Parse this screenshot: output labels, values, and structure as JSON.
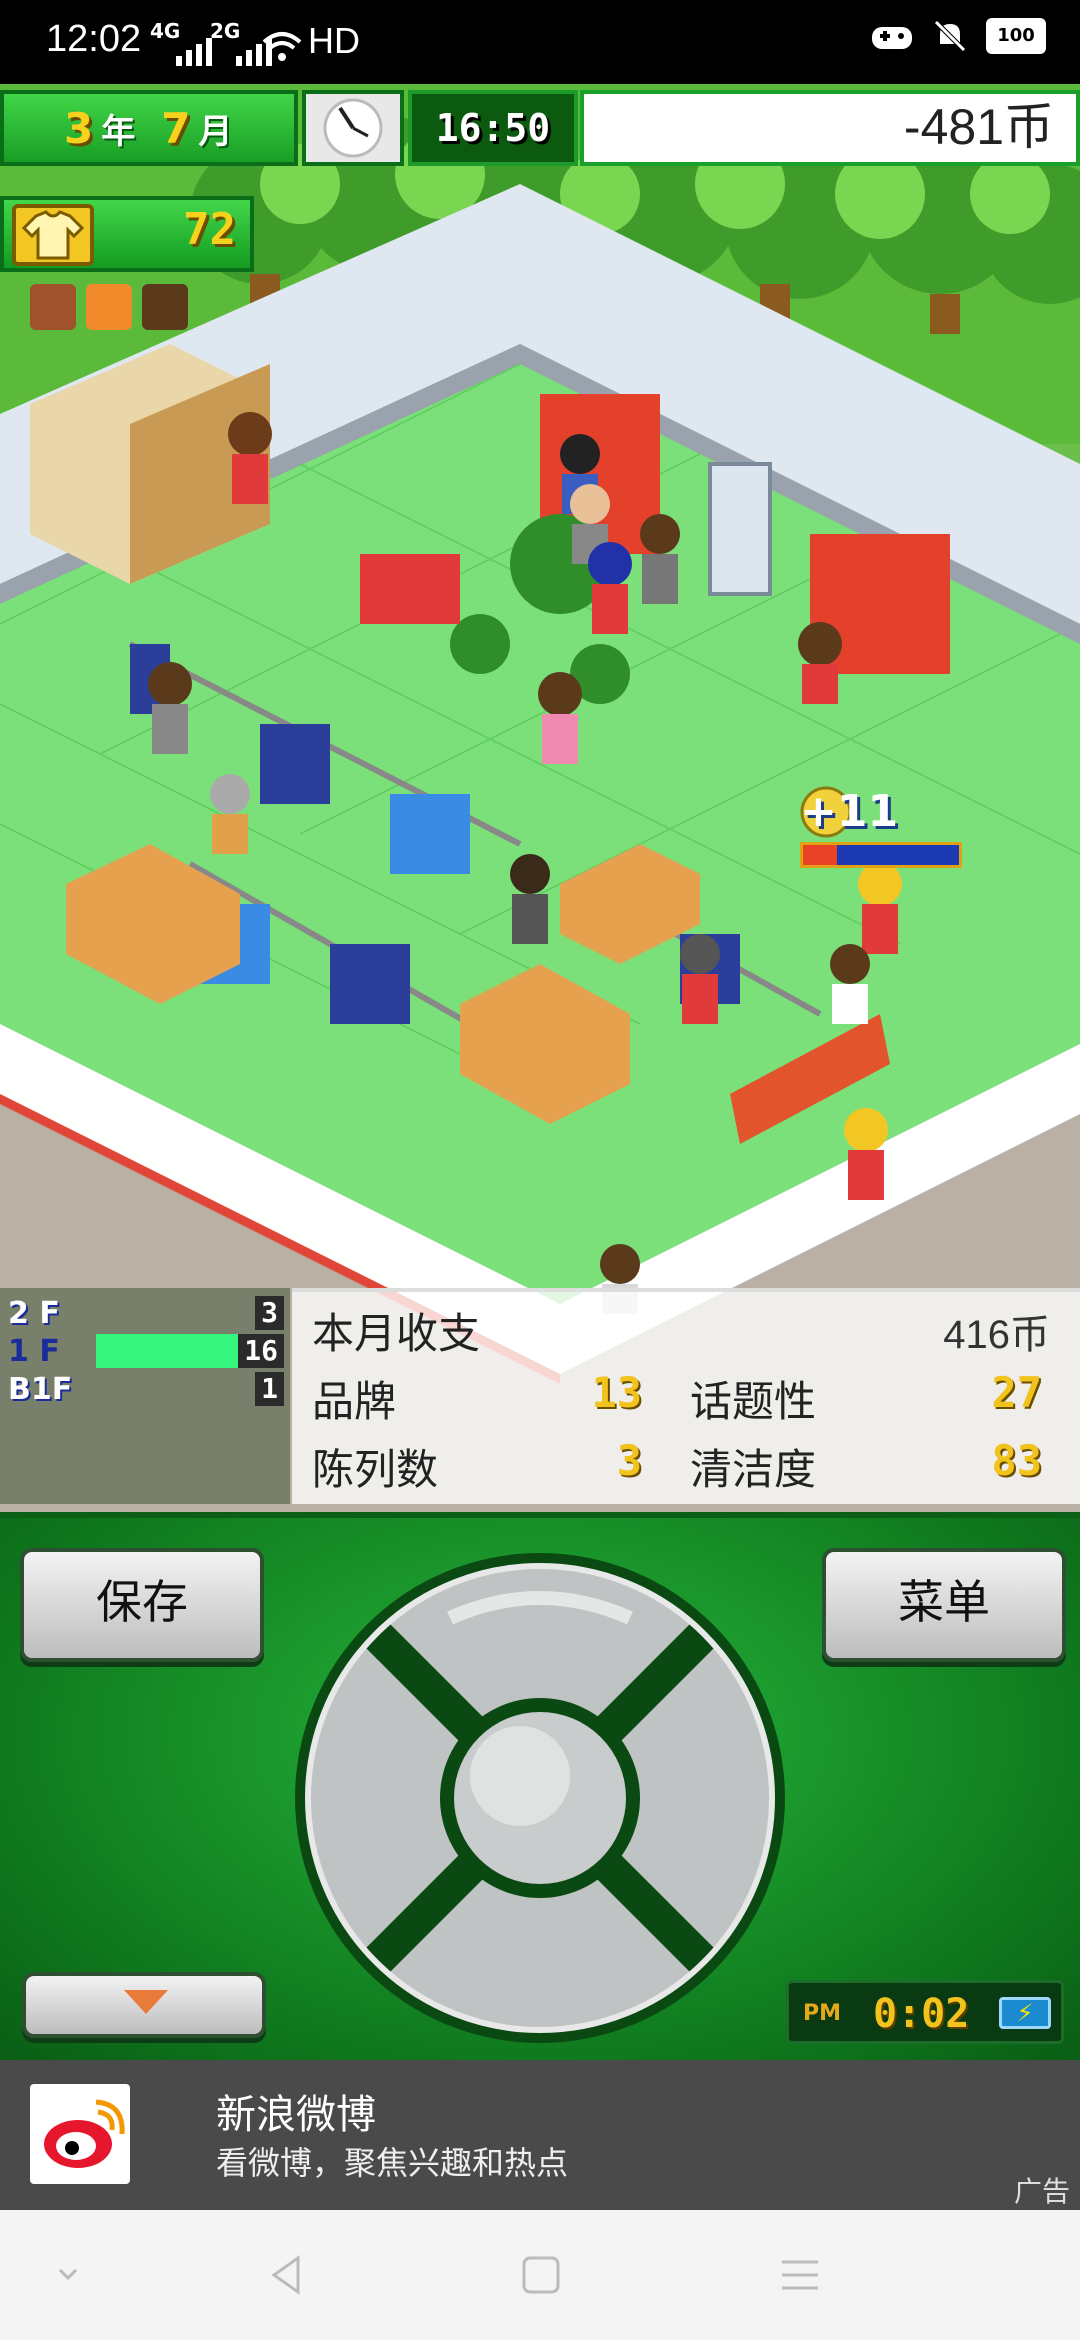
{
  "status_bar": {
    "time": "12:02",
    "sig1_tech": "4G",
    "sig2_tech": "2G",
    "hd_label": "HD",
    "battery": "100"
  },
  "hud": {
    "year_num": "3",
    "year_label": "年",
    "month_num": "7",
    "month_label": "月",
    "time": "16:50",
    "money": "-481币",
    "rank_value": "72",
    "floating_bonus": "+11",
    "floating_bar_fraction": 0.22
  },
  "floors": [
    {
      "label": "2 F",
      "count": "3",
      "active": false
    },
    {
      "label": "1 F",
      "count": "16",
      "active": true
    },
    {
      "label": "B1F",
      "count": "1",
      "active": false
    }
  ],
  "stats": {
    "monthly_label": "本月收支",
    "monthly_value": "416币",
    "brand_label": "品牌",
    "brand_value": "13",
    "topic_label": "话题性",
    "topic_value": "27",
    "display_label": "陈列数",
    "display_value": "3",
    "clean_label": "清洁度",
    "clean_value": "83"
  },
  "controller": {
    "save_label": "保存",
    "menu_label": "菜单",
    "clock_ampm": "PM",
    "clock_time": "0:02"
  },
  "ad": {
    "title": "新浪微博",
    "subtitle": "看微博，聚焦兴趣和热点",
    "tag": "广告"
  },
  "icons": {
    "wifi": "wifi-icon",
    "gamepad": "gamepad-icon",
    "mute": "bell-off-icon",
    "weibo": "weibo-logo-icon"
  },
  "colors": {
    "hud_green": "#19a02a",
    "gold": "#f3c31d",
    "floor_active": "#36f57f",
    "ad_bg": "#4a4a4a"
  }
}
